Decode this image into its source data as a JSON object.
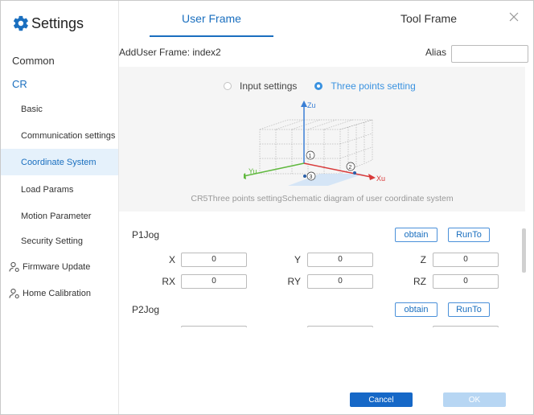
{
  "app": {
    "title": "Settings"
  },
  "sidebar": {
    "items": [
      {
        "label": "Common"
      },
      {
        "label": "CR"
      },
      {
        "label": "Basic"
      },
      {
        "label": "Communication settings"
      },
      {
        "label": "Coordinate System"
      },
      {
        "label": "Load Params"
      },
      {
        "label": "Motion Parameter"
      },
      {
        "label": "Security Setting"
      },
      {
        "label": "Firmware Update"
      },
      {
        "label": "Home Calibration"
      }
    ]
  },
  "tabs": [
    {
      "label": "User Frame"
    },
    {
      "label": "Tool Frame"
    }
  ],
  "frame": {
    "label": "AddUser Frame: index2",
    "alias_label": "Alias",
    "alias_value": ""
  },
  "mode": {
    "options": [
      {
        "label": "Input settings"
      },
      {
        "label": "Three points setting"
      }
    ],
    "selected": "Three points setting"
  },
  "diagram": {
    "caption": "CR5Three points settingSchematic diagram of user coordinate system",
    "axes": {
      "z": "Zu",
      "y": "Yu",
      "x": "Xu"
    },
    "points": [
      "1",
      "2",
      "3"
    ]
  },
  "p1": {
    "title": "P1Jog",
    "obtain_label": "obtain",
    "runto_label": "RunTo",
    "fields": {
      "x": {
        "label": "X",
        "value": "0"
      },
      "y": {
        "label": "Y",
        "value": "0"
      },
      "z": {
        "label": "Z",
        "value": "0"
      },
      "rx": {
        "label": "RX",
        "value": "0"
      },
      "ry": {
        "label": "RY",
        "value": "0"
      },
      "rz": {
        "label": "RZ",
        "value": "0"
      }
    }
  },
  "p2": {
    "title": "P2Jog",
    "obtain_label": "obtain",
    "runto_label": "RunTo"
  },
  "footer": {
    "cancel_label": "Cancel",
    "ok_label": "OK"
  },
  "colors": {
    "accent": "#1a6fbf",
    "active_bg": "#e5f1fb",
    "primary_button": "#1668c7",
    "disabled_button": "#b7d6f3"
  }
}
